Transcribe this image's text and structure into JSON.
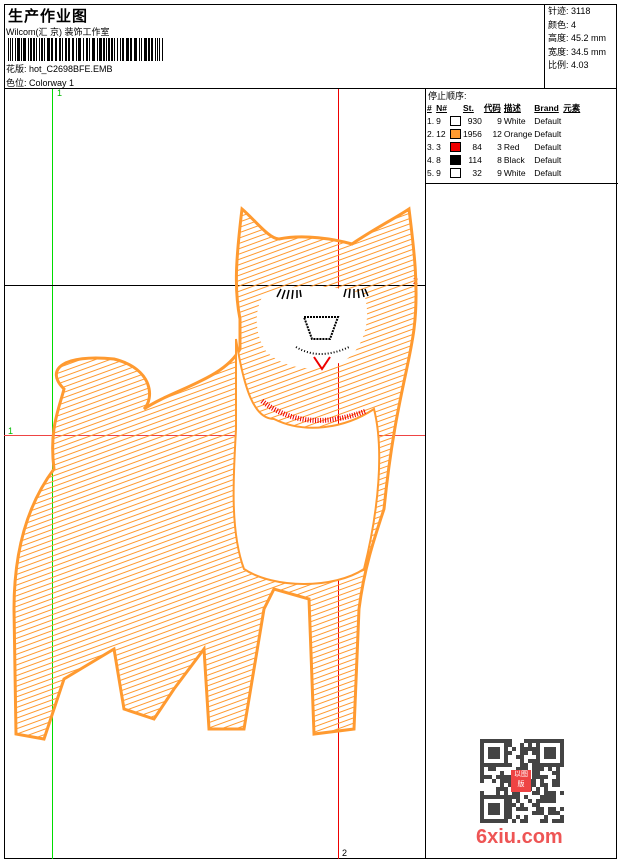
{
  "header": {
    "title": "生产作业图",
    "studio": "Wilcom(汇 京) 装饰工作室",
    "pattern": "花版:  hot_C2698BFE.EMB",
    "colorway": "色位:  Colorway 1"
  },
  "info": {
    "stitches": "针迹: 3118",
    "colors": "颜色: 4",
    "height": "高度: 45.2 mm",
    "width": "宽度: 34.5 mm",
    "scale": "比例: 4.03"
  },
  "stop_sequence": {
    "title": "停止顺序:",
    "headers": [
      "#",
      "N#",
      "",
      "St.",
      "代码",
      "描述",
      "Brand",
      "元素"
    ],
    "rows": [
      {
        "idx": "1.",
        "n": "9",
        "color": "#ffffff",
        "st": "930",
        "code": "9",
        "desc": "White",
        "brand": "Default"
      },
      {
        "idx": "2.",
        "n": "12",
        "color": "#ff9a30",
        "st": "1956",
        "code": "12",
        "desc": "Orange",
        "brand": "Default"
      },
      {
        "idx": "3.",
        "n": "3",
        "color": "#ee0000",
        "st": "84",
        "code": "3",
        "desc": "Red",
        "brand": "Default"
      },
      {
        "idx": "4.",
        "n": "8",
        "color": "#000000",
        "st": "114",
        "code": "8",
        "desc": "Black",
        "brand": "Default"
      },
      {
        "idx": "5.",
        "n": "9",
        "color": "#ffffff",
        "st": "32",
        "code": "9",
        "desc": "White",
        "brand": "Default"
      }
    ]
  },
  "guides": {
    "top": "1",
    "bottom": "2",
    "left": "1",
    "right": "2"
  },
  "watermark": {
    "text": "6xiu.com",
    "seal": "以图版"
  }
}
